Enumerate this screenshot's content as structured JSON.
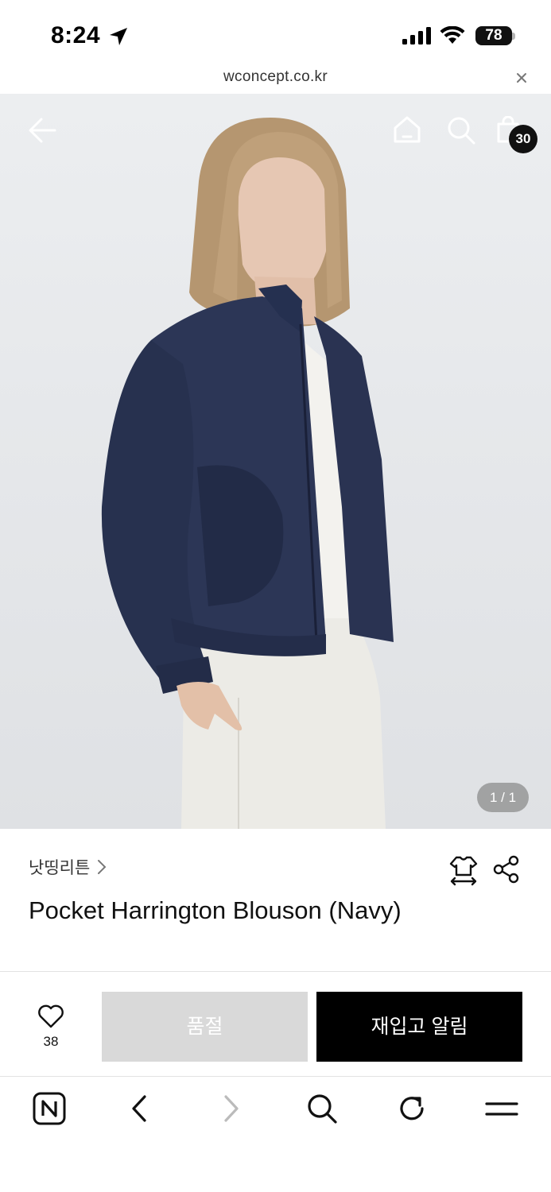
{
  "status_bar": {
    "time": "8:24",
    "battery": "78"
  },
  "browser": {
    "url": "wconcept.co.kr"
  },
  "hero": {
    "cart_count": "30",
    "page_indicator": "1 / 1"
  },
  "product": {
    "brand": "낫띵리튼",
    "title": "Pocket Harrington Blouson (Navy)"
  },
  "actions": {
    "like_count": "38",
    "soldout_label": "품절",
    "restock_label": "재입고 알림"
  },
  "icons": {
    "back": "arrow-left-icon",
    "home": "home-icon",
    "search": "search-icon",
    "cart": "shopping-bag-icon",
    "size": "size-guide-icon",
    "share": "share-icon",
    "like": "heart-icon",
    "naver": "naver-icon",
    "nav_back": "chevron-left-icon",
    "nav_forward": "chevron-right-icon",
    "nav_search": "search-icon",
    "reload": "reload-icon",
    "menu": "menu-icon"
  },
  "colors": {
    "primary_button": "#000000",
    "disabled_button": "#d9d9d9",
    "badge": "#111111"
  }
}
